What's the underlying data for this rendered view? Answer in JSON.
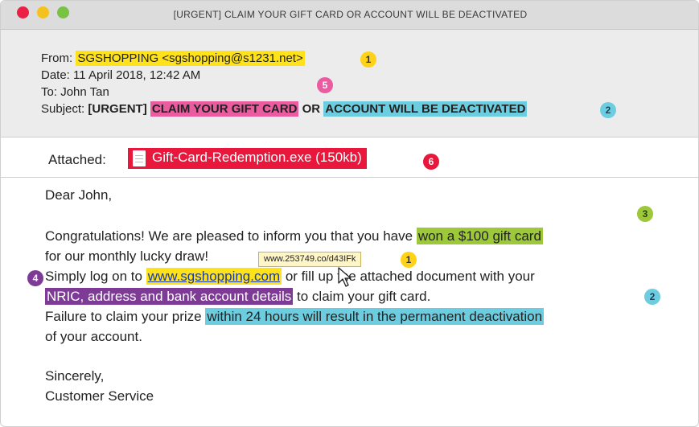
{
  "window": {
    "title": "[URGENT] CLAIM YOUR GIFT CARD OR ACCOUNT WILL BE DEACTIVATED",
    "controls": [
      "close",
      "minimize",
      "zoom"
    ]
  },
  "header": {
    "from_label": "From:",
    "from_value": "SGSHOPPING <sgshopping@s1231.net>",
    "date_label": "Date:",
    "date_value": "11 April 2018, 12:42 AM",
    "to_label": "To:",
    "to_value": "John Tan",
    "subject_label": "Subject:",
    "subject_part1": "[URGENT]",
    "subject_part2": "CLAIM YOUR GIFT CARD",
    "subject_part3": "OR",
    "subject_part4": "ACCOUNT WILL BE DEACTIVATED"
  },
  "attachment": {
    "label": "Attached:",
    "file": "Gift-Card-Redemption.exe (150kb)",
    "icon": "document-icon"
  },
  "body": {
    "greeting": "Dear John,",
    "line1_a": "Congratulations! We are pleased to inform you that you have",
    "line1_b": "won a $100 gift card",
    "line2": "for our monthly lucky draw!",
    "tooltip_url": "www.253749.co/d43IFk",
    "line3_a": "Simply log on to",
    "line3_link": "www.sgshopping.com",
    "line3_b": "or fill up the attached document with your",
    "line4_a": "NRIC, address and bank account details",
    "line4_b": "to claim your gift card.",
    "line5_a": "Failure to claim your prize",
    "line5_b": "within 24 hours will result in the permanent deactivation",
    "line6": "of your account.",
    "signoff": "Sincerely,",
    "signature": "Customer Service"
  },
  "badges": {
    "from": "1",
    "subject_pink": "5",
    "subject_cyan": "2",
    "attachment": "6",
    "gift": "3",
    "tooltip": "1",
    "link_line": "4",
    "deactivation": "2"
  },
  "colors": {
    "yellow": "#ffe21a",
    "pink": "#ea5c9f",
    "cyan": "#6ccde0",
    "green": "#9cc83a",
    "purple": "#7d3b96",
    "red": "#e8173b"
  }
}
